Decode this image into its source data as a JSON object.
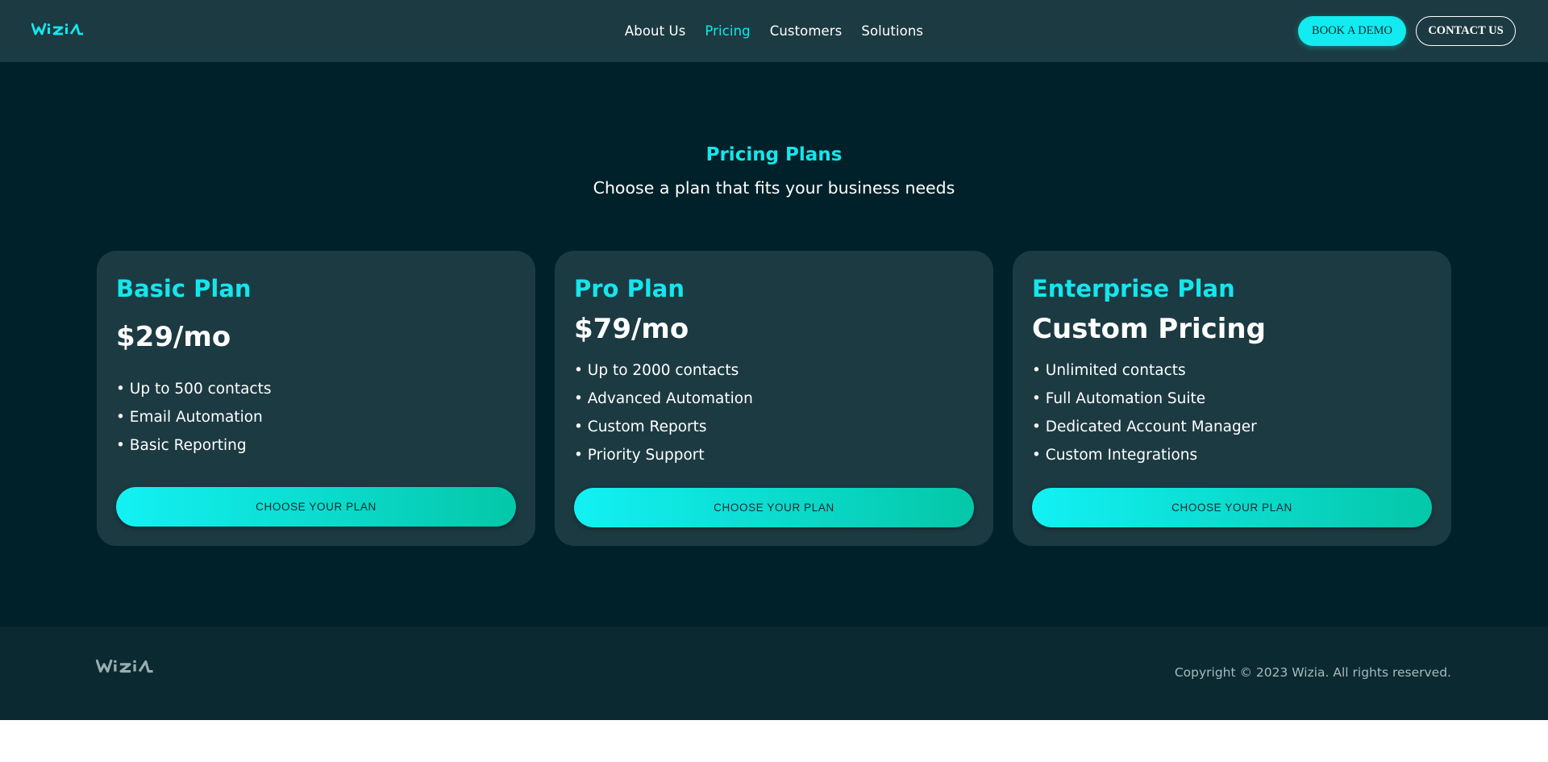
{
  "brand": {
    "logo_text": "WiZiA",
    "accent_color": "#14e6ec"
  },
  "nav": {
    "items": [
      {
        "label": "About Us",
        "active": false
      },
      {
        "label": "Pricing",
        "active": true
      },
      {
        "label": "Customers",
        "active": false
      },
      {
        "label": "Solutions",
        "active": false
      }
    ]
  },
  "header_actions": {
    "book_demo": "BOOK A DEMO",
    "contact_us": "CONTACT US"
  },
  "pricing": {
    "title": "Pricing Plans",
    "subtitle": "Choose a plan that fits your business needs",
    "plans": [
      {
        "name": "Basic Plan",
        "price": "$29/mo",
        "features": [
          "• Up to 500 contacts",
          "• Email Automation",
          "• Basic Reporting"
        ],
        "cta": "CHOOSE YOUR PLAN"
      },
      {
        "name": "Pro Plan",
        "price": "$79/mo",
        "features": [
          "• Up to 2000 contacts",
          "• Advanced Automation",
          "• Custom Reports",
          "• Priority Support"
        ],
        "cta": "CHOOSE YOUR PLAN"
      },
      {
        "name": "Enterprise Plan",
        "price": "Custom Pricing",
        "features": [
          "• Unlimited contacts",
          "• Full Automation Suite",
          "• Dedicated Account Manager",
          "• Custom Integrations"
        ],
        "cta": "CHOOSE YOUR PLAN"
      }
    ]
  },
  "footer": {
    "copyright": "Copyright © 2023 Wizia. All rights reserved."
  }
}
